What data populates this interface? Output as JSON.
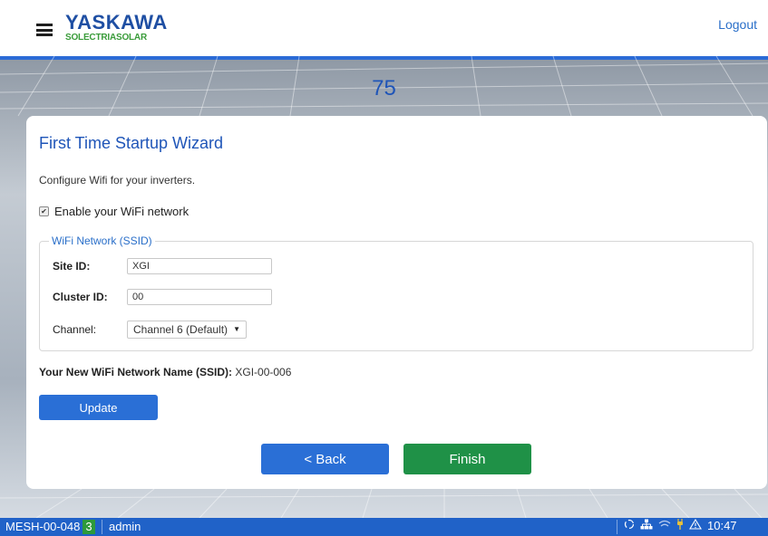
{
  "header": {
    "logo_main": "YASKAWA",
    "logo_sub": "SOLECTRIASOLAR",
    "logout_label": "Logout"
  },
  "progress": {
    "percent_label": "75"
  },
  "wizard": {
    "title": "First Time Startup Wizard",
    "description": "Configure Wifi for your inverters.",
    "enable_wifi": {
      "label": "Enable your WiFi network",
      "checked": true
    },
    "fieldset": {
      "legend": "WiFi Network (SSID)",
      "site_id": {
        "label": "Site ID:",
        "value": "XGI"
      },
      "cluster_id": {
        "label": "Cluster ID:",
        "value": "00"
      },
      "channel": {
        "label": "Channel:",
        "selected": "Channel 6 (Default)"
      }
    },
    "ssid_line": {
      "label": "Your New WiFi Network Name (SSID):",
      "value": "XGI-00-006"
    },
    "update_label": "Update",
    "back_label": "< Back",
    "finish_label": "Finish"
  },
  "statusbar": {
    "device": "MESH-00-048",
    "count": "3",
    "user": "admin",
    "icons": [
      "sync-icon",
      "network-icon",
      "wifi-icon",
      "plug-icon",
      "warning-icon"
    ],
    "time": "10:47"
  },
  "colors": {
    "accent_blue": "#2a6fd6",
    "finish_green": "#1f9147",
    "statusbar_blue": "#2062c8",
    "count_green": "#2e9a3b",
    "plug_yellow": "#e8c13a"
  }
}
